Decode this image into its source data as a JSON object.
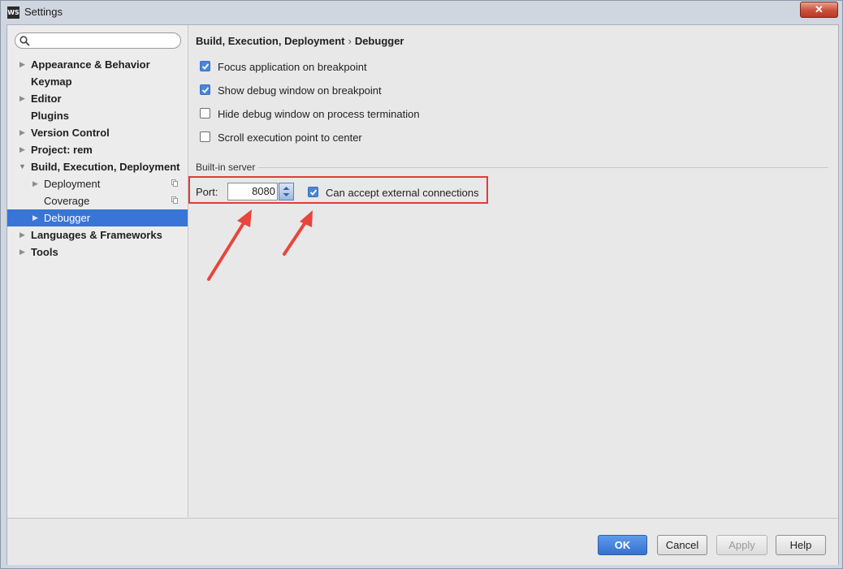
{
  "window": {
    "title": "Settings",
    "app_icon_text": "WS"
  },
  "search": {
    "value": "",
    "placeholder": ""
  },
  "sidebar": {
    "items": [
      {
        "label": "Appearance & Behavior"
      },
      {
        "label": "Keymap"
      },
      {
        "label": "Editor"
      },
      {
        "label": "Plugins"
      },
      {
        "label": "Version Control"
      },
      {
        "label": "Project: rem"
      },
      {
        "label": "Build, Execution, Deployment"
      },
      {
        "label": "Deployment"
      },
      {
        "label": "Coverage"
      },
      {
        "label": "Debugger"
      },
      {
        "label": "Languages & Frameworks"
      },
      {
        "label": "Tools"
      }
    ]
  },
  "breadcrumb": {
    "parent": "Build, Execution, Deployment",
    "separator": "›",
    "current": "Debugger"
  },
  "options": [
    {
      "label": "Focus application on breakpoint",
      "checked": true
    },
    {
      "label": "Show debug window on breakpoint",
      "checked": true
    },
    {
      "label": "Hide debug window on process termination",
      "checked": false
    },
    {
      "label": "Scroll execution point to center",
      "checked": false
    }
  ],
  "builtin_server": {
    "title": "Built-in server",
    "port_label": "Port:",
    "port_value": "8080",
    "external_label": "Can accept external connections",
    "external_checked": true
  },
  "footer": {
    "ok": "OK",
    "cancel": "Cancel",
    "apply": "Apply",
    "help": "Help"
  },
  "colors": {
    "selection": "#3875d6",
    "annotation": "#e03b3b",
    "ok_button": "#3d7bd6"
  }
}
